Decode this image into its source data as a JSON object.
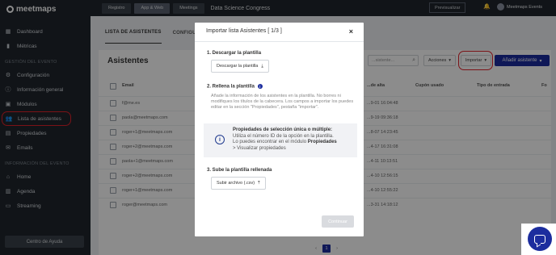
{
  "app": {
    "brand": "meetmaps"
  },
  "topbar": {
    "tabs": [
      "Registro",
      "App & Web",
      "Meetings"
    ],
    "event_name": "Data Science Congress",
    "preview": "Previsualizar",
    "user": "Meetmaps Events"
  },
  "sidebar": {
    "items": [
      {
        "label": "Dashboard",
        "icon": "grid-icon"
      },
      {
        "label": "Métricas",
        "icon": "bar-chart-icon"
      }
    ],
    "section1": "GESTIÓN DEL EVENTO",
    "items2": [
      {
        "label": "Configuración",
        "icon": "gear-icon"
      },
      {
        "label": "Información general",
        "icon": "info-icon"
      },
      {
        "label": "Módulos",
        "icon": "modules-icon"
      },
      {
        "label": "Lista de asistentes",
        "icon": "users-icon"
      },
      {
        "label": "Propiedades",
        "icon": "properties-icon"
      },
      {
        "label": "Emails",
        "icon": "mail-icon"
      }
    ],
    "section2": "INFORMACIÓN DEL EVENTO",
    "items3": [
      {
        "label": "Home",
        "icon": "home-icon"
      },
      {
        "label": "Agenda",
        "icon": "calendar-icon"
      },
      {
        "label": "Streaming",
        "icon": "streaming-icon"
      }
    ],
    "help": "Centro de Ayuda"
  },
  "main": {
    "tabs": [
      "LISTA DE ASISTENTES",
      "CONFIGURA"
    ],
    "title": "Asistentes",
    "search_placeholder": "...sistente...",
    "actions": "Acciones",
    "import": "Importar",
    "add": "Añadir asistente",
    "columns": [
      "Email",
      "...de alta",
      "Cupón usado",
      "Tipo de entrada",
      "Fo"
    ],
    "rows": [
      {
        "email": "f@me.es",
        "date": "...9-01 16:04:48"
      },
      {
        "email": "paola@meetmaps.com",
        "date": "...9-19 09:36:18"
      },
      {
        "email": "roger+1@meetmaps.com",
        "date": "...8-07 14:23:45"
      },
      {
        "email": "roger+2@meetmaps.com",
        "date": "...4-17 16:31:08"
      },
      {
        "email": "paola+1@meetmaps.com",
        "date": "...4-11 10:13:51"
      },
      {
        "email": "roger+2@meetmaps.com",
        "date": "...4-10 12:56:15"
      },
      {
        "email": "roger+1@meetmaps.com",
        "date": "...4-10 12:55:22"
      },
      {
        "email": "roger@meetmaps.com",
        "date": "...3-31 14:18:12"
      }
    ],
    "pager": {
      "prev": "‹",
      "current": "1",
      "next": "›"
    }
  },
  "modal": {
    "title": "Importar lista Asistentes [ 1/3 ]",
    "close": "×",
    "step1": "1. Descargar la plantilla",
    "step1_btn": "Descargar la plantilla",
    "step2": "2. Rellena la plantilla",
    "step2_text": "Añade la información de los asistentes en la plantilla. No borres ni modifiques los títulos de la cabecera. Los campos a importar los puedes editar en la sección \"Propiedades\", pestaña \"importar\".",
    "info_title": "Propiedades de selección única o múltiple:",
    "info_line1": "Utiliza el número ID de la opción en la plantilla.",
    "info_line2_pre": "Lo puedes encontrar en el módulo ",
    "info_line2_bold": "Propiedades",
    "info_line3": "> Visualizar propiedades",
    "step3": "3. Sube la plantilla rellenada",
    "step3_btn": "Subir archivo (.csv)",
    "continue": "Continuar"
  },
  "colors": {
    "primary": "#1c2d9e",
    "sidebar": "#1f252c",
    "highlight": "#e0212b"
  }
}
